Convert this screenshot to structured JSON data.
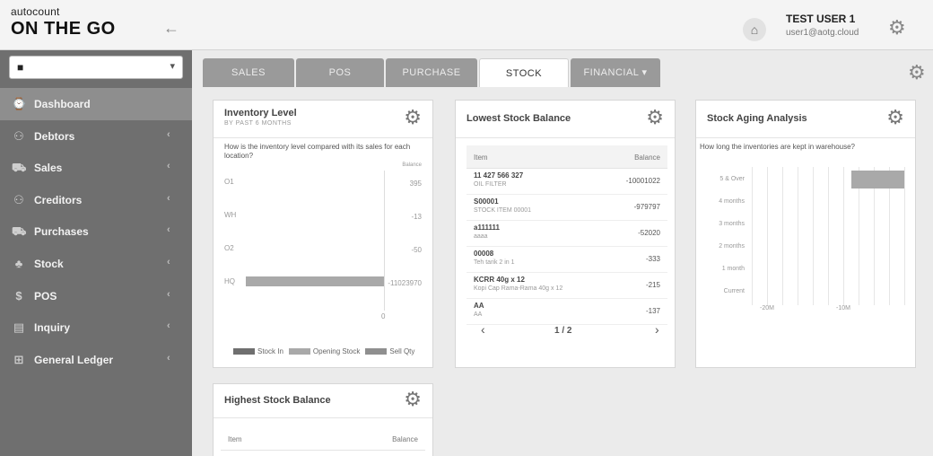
{
  "app": {
    "logo_small": "autocount",
    "logo_big": "ON THE GO"
  },
  "header": {
    "user_name": "TEST USER 1",
    "user_email": "user1@aotg.cloud"
  },
  "sidebar": {
    "items": [
      {
        "label": "Dashboard",
        "icon": "dashboard-icon",
        "glyph": "⌚",
        "active": true
      },
      {
        "label": "Debtors",
        "icon": "debtors-icon",
        "glyph": "⚇"
      },
      {
        "label": "Sales",
        "icon": "sales-icon",
        "glyph": "⛟"
      },
      {
        "label": "Creditors",
        "icon": "creditors-icon",
        "glyph": "⚇"
      },
      {
        "label": "Purchases",
        "icon": "purchases-icon",
        "glyph": "⛟"
      },
      {
        "label": "Stock",
        "icon": "stock-icon",
        "glyph": "♣"
      },
      {
        "label": "POS",
        "icon": "dollar-icon",
        "glyph": "$"
      },
      {
        "label": "Inquiry",
        "icon": "inquiry-icon",
        "glyph": "▤"
      },
      {
        "label": "General Ledger",
        "icon": "ledger-icon",
        "glyph": "⊞"
      }
    ]
  },
  "tabs": [
    {
      "label": "SALES"
    },
    {
      "label": "POS"
    },
    {
      "label": "PURCHASE"
    },
    {
      "label": "STOCK",
      "active": true
    },
    {
      "label": "FINANCIAL ▾"
    }
  ],
  "inventory_level": {
    "title": "Inventory Level",
    "subtitle": "BY PAST 6 MONTHS",
    "question": "How is the inventory level compared with its sales for each location?",
    "balance_header": "Balance",
    "axis_zero": "0",
    "legend": [
      "Stock In",
      "Opening Stock",
      "Sell Qty"
    ],
    "chart_data": {
      "type": "bar",
      "categories": [
        "O1",
        "WH",
        "O2",
        "HQ"
      ],
      "balance": [
        "395",
        "-13",
        "-50",
        "-11023970"
      ],
      "series": [
        {
          "name": "Stock In",
          "color": "#6f6f6f",
          "values": [
            0,
            0,
            0,
            0
          ]
        },
        {
          "name": "Opening Stock",
          "color": "#a9a9a9",
          "values": [
            0,
            0,
            0,
            -11023970
          ]
        },
        {
          "name": "Sell Qty",
          "color": "#8f8f8f",
          "values": [
            0,
            0,
            0,
            0
          ]
        }
      ]
    }
  },
  "lowest_stock": {
    "title": "Lowest Stock Balance",
    "col_item": "Item",
    "col_balance": "Balance",
    "rows": [
      {
        "code": "11 427 566 327",
        "desc": "OIL FILTER",
        "balance": "-10001022"
      },
      {
        "code": "S00001",
        "desc": "STOCK ITEM 00001",
        "balance": "-979797"
      },
      {
        "code": "a111111",
        "desc": "aaaa",
        "balance": "-52020"
      },
      {
        "code": "00008",
        "desc": "Teh tarik 2 in 1",
        "balance": "-333"
      },
      {
        "code": "KCRR 40g x 12",
        "desc": "Kopi Cap Rama-Rama 40g x 12",
        "balance": "-215"
      },
      {
        "code": "AA",
        "desc": "AA",
        "balance": "-137"
      }
    ],
    "pager": "1 / 2"
  },
  "stock_aging": {
    "title": "Stock Aging Analysis",
    "question": "How long the inventories are kept in warehouse?",
    "chart_data": {
      "type": "bar",
      "orientation": "horizontal",
      "categories": [
        "5 & Over",
        "4 months",
        "3 months",
        "2 months",
        "1 month",
        "Current"
      ],
      "values": [
        -7000000,
        0,
        0,
        0,
        0,
        0
      ],
      "xlim": [
        -20000000,
        0
      ],
      "x_ticks": [
        "-20M",
        "-10M"
      ]
    }
  },
  "highest_stock": {
    "title": "Highest Stock Balance",
    "col_item": "Item",
    "col_balance": "Balance"
  }
}
